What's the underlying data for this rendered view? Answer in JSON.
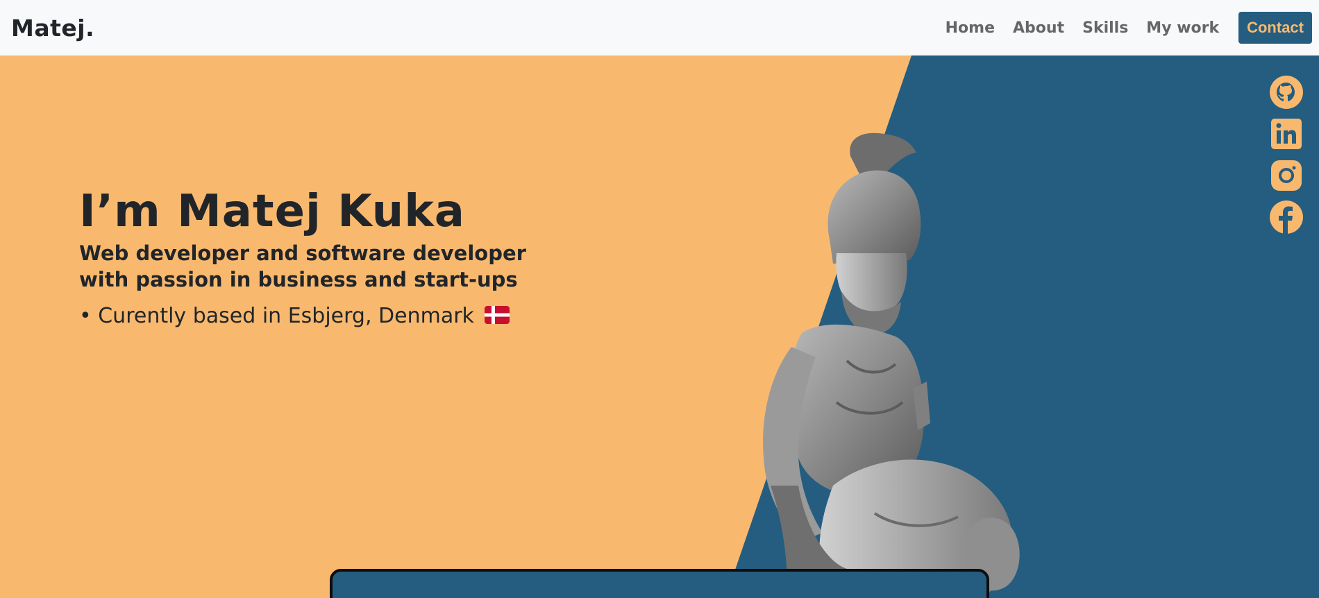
{
  "navbar": {
    "brand": "Matej.",
    "links": [
      "Home",
      "About",
      "Skills",
      "My work"
    ],
    "contact_label": "Contact"
  },
  "hero": {
    "headline": "I’m Matej Kuka",
    "subtitle_line1": "Web developer and software developer",
    "subtitle_line2": "with passion in business and start-ups",
    "location": "• Curently based in Esbjerg, Denmark",
    "flag_icon": "denmark-flag-icon"
  },
  "socials": [
    {
      "icon": "github-icon"
    },
    {
      "icon": "linkedin-icon"
    },
    {
      "icon": "instagram-icon"
    },
    {
      "icon": "facebook-icon"
    }
  ],
  "colors": {
    "orange": "#f8b96f",
    "blue": "#245d80",
    "dark": "#212529",
    "navbar_bg": "#f8f9fb"
  }
}
